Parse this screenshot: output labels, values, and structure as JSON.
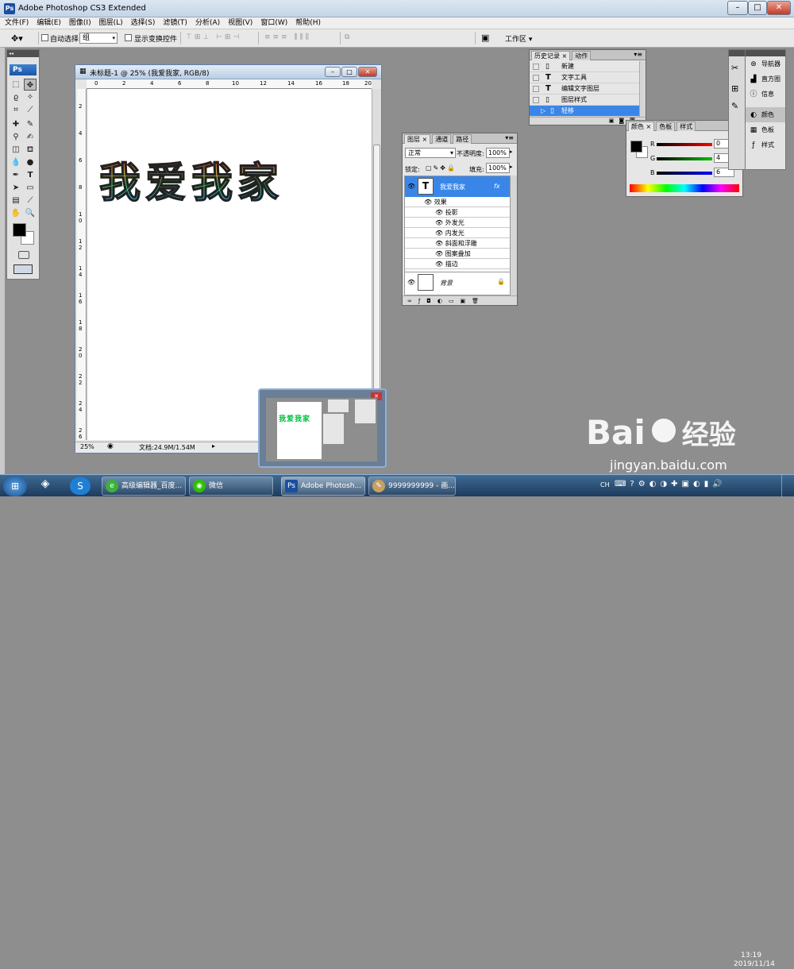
{
  "app": {
    "title": "Adobe Photoshop CS3 Extended",
    "logo": "Ps"
  },
  "window_controls": {
    "minimize": "–",
    "maximize": "□",
    "close": "✕"
  },
  "menu": [
    "文件(F)",
    "编辑(E)",
    "图像(I)",
    "图层(L)",
    "选择(S)",
    "滤镜(T)",
    "分析(A)",
    "视图(V)",
    "窗口(W)",
    "帮助(H)"
  ],
  "options_bar": {
    "auto_select_label": "自动选择:",
    "auto_select_value": "组",
    "show_transform_label": "显示变换控件",
    "workspace_label": "工作区 ▾"
  },
  "document": {
    "title": "未标题-1 @ 25% (我爱我家, RGB/8)",
    "canvas_text": "我爱我家",
    "zoom": "25%",
    "doc_size": "文档:24.9M/1.54M",
    "ruler_top": [
      "0",
      "2",
      "4",
      "6",
      "8",
      "10",
      "12",
      "14",
      "16",
      "18",
      "20"
    ],
    "ruler_left": [
      "2",
      "4",
      "6",
      "8",
      "1 0",
      "1 2",
      "1 4",
      "1 6",
      "1 8",
      "2 0",
      "2 2",
      "2 4",
      "2 6"
    ]
  },
  "history_panel": {
    "tabs": [
      "历史记录",
      "动作"
    ],
    "items": [
      {
        "label": "新建",
        "icon": "doc-icon"
      },
      {
        "label": "文字工具",
        "icon": "T"
      },
      {
        "label": "编辑文字图层",
        "icon": "T"
      },
      {
        "label": "图层样式",
        "icon": "doc-icon"
      },
      {
        "label": "轻移",
        "icon": "doc-icon",
        "selected": true
      }
    ]
  },
  "layers_panel": {
    "tabs": [
      "图层",
      "通道",
      "路径"
    ],
    "blend_mode": "正常",
    "opacity_label": "不透明度:",
    "opacity": "100%",
    "lock_label": "锁定:",
    "fill_label": "填充:",
    "fill": "100%",
    "text_layer": "我爱我家",
    "effects_label": "效果",
    "effects": [
      "投影",
      "外发光",
      "内发光",
      "斜面和浮雕",
      "图案叠加",
      "描边"
    ],
    "background_layer": "背景",
    "fx_label": "fx"
  },
  "color_panel": {
    "tabs": [
      "颜色",
      "色板",
      "样式"
    ],
    "channels": [
      {
        "label": "R",
        "value": "0",
        "color": "#ff0000"
      },
      {
        "label": "G",
        "value": "4",
        "color": "#00b000"
      },
      {
        "label": "B",
        "value": "6",
        "color": "#0000ff"
      }
    ]
  },
  "dock": {
    "items": [
      "导航器",
      "直方图",
      "信息",
      "颜色",
      "色板",
      "样式"
    ]
  },
  "taskbar": {
    "items": [
      "高级编辑器_百度...",
      "微信",
      "Adobe Photosh...",
      "9999999999 - 画..."
    ],
    "lang": "CH",
    "time": "13:19",
    "date": "2019/11/14"
  },
  "watermark": {
    "brand": "Bai",
    "brand2": "经验",
    "url": "jingyan.baidu.com"
  }
}
